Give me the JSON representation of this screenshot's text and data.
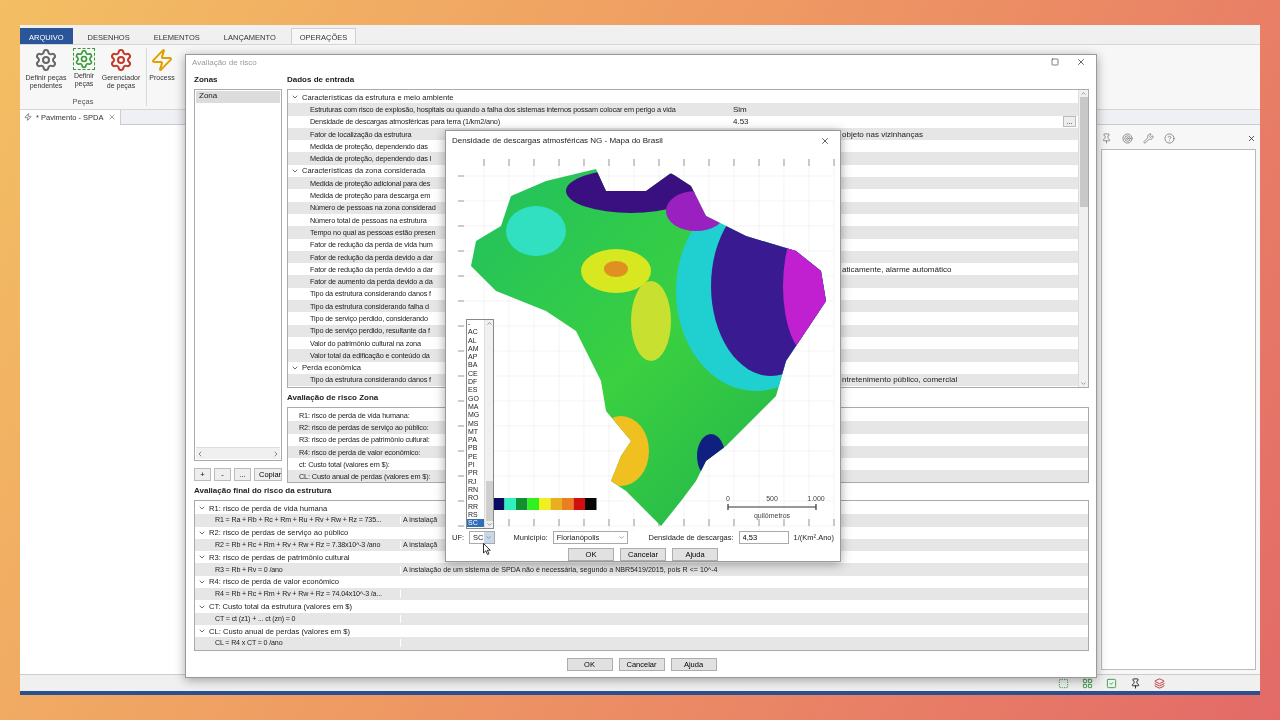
{
  "app": {
    "tabs": [
      {
        "label": "ARQUIVO",
        "kind": "file",
        "selected": false
      },
      {
        "label": "DESENHOS",
        "kind": "tab",
        "selected": false
      },
      {
        "label": "ELEMENTOS",
        "kind": "tab",
        "selected": false
      },
      {
        "label": "LANÇAMENTO",
        "kind": "tab",
        "selected": false
      },
      {
        "label": "OPERAÇÕES",
        "kind": "tab",
        "selected": true
      }
    ],
    "ribbon": {
      "buttons": [
        {
          "label": "Definir peças pendentes",
          "kind": "warn"
        },
        {
          "label": "Definir peças",
          "kind": "dashed"
        },
        {
          "label": "Gerenciador de peças",
          "kind": "manage"
        },
        {
          "label": "Process",
          "kind": "process"
        }
      ],
      "group_label": "Peças"
    },
    "document_tab": {
      "label": "* Pavimento - SPDA"
    }
  },
  "risk_dialog": {
    "title": "Avaliação de risco",
    "zones_heading": "Zonas",
    "zones": [
      {
        "label": "Zona",
        "selected": true
      }
    ],
    "zone_buttons": [
      "+",
      "-",
      "...",
      "Copiar"
    ],
    "input_heading": "Dados de entrada",
    "input_groups": [
      {
        "label": "Características da estrutura e meio ambiente",
        "expanded": true,
        "rows": [
          {
            "label": "Estruturas com risco de explosão, hospitais ou quando a falha dos sistemas internos possam colocar em perigo a vida",
            "value": "Sim"
          },
          {
            "label": "Densidade de descargas atmosféricas para terra (1/km2/ano)",
            "value": "4.53",
            "button": "..."
          },
          {
            "label": "Fator de localização da estrutura",
            "value": "objeto nas vizinhanças"
          },
          {
            "label": "Medida de proteção, dependendo das"
          },
          {
            "label": "Medida de proteção, dependendo das l"
          }
        ]
      },
      {
        "label": "Características da zona considerada",
        "expanded": true,
        "rows": [
          {
            "label": "Medida de proteção adicional para des"
          },
          {
            "label": "Medida de proteção para descarga em"
          },
          {
            "label": "Número de pessoas na zona considerad"
          },
          {
            "label": "Número total de pessoas na estrutura"
          },
          {
            "label": "Tempo no qual as pessoas estão presen"
          },
          {
            "label": "Fator de redução da perda de vida hum"
          },
          {
            "label": "Fator de redução da perda devido a dar"
          },
          {
            "label": "Fator de redução da perda devido a dar",
            "value": "aticamente, alarme automático"
          },
          {
            "label": "Fator de aumento da perda devido a da"
          },
          {
            "label": "Tipo da estrutura considerando danos f"
          },
          {
            "label": "Tipo da estrutura considerando falha d"
          },
          {
            "label": "Tipo de serviço perdido, considerando"
          },
          {
            "label": "Tipo de serviço perdido, resultante da f"
          },
          {
            "label": "Valor do patrimônio cultural na zona"
          },
          {
            "label": "Valor total da edificação e conteúdo da"
          }
        ]
      },
      {
        "label": "Perda econômica",
        "expanded": true,
        "rows": [
          {
            "label": "Tipo da estrutura considerando danos f",
            "value": "ntretenimento público, comercial"
          }
        ]
      }
    ],
    "risk_heading": "Avaliação de risco Zona",
    "risk_rows": [
      "R1: risco de perda de vida humana:",
      "R2: risco de perdas de serviço ao público:",
      "R3: risco de perdas de patrimônio cultural:",
      "R4: risco de perda de valor econômico:",
      "ct: Custo total (valores em $):",
      "CL: Custo anual de perdas (valores em $):"
    ],
    "final_heading": "Avaliação final do risco da estrutura",
    "final_groups": [
      {
        "label": "R1: risco de perda de vida humana",
        "expanded": true,
        "rows": [
          {
            "formula": "R1 = Ra + Rb + Rc + Rm + Ru + Rv + Rw + Rz = 735...",
            "note": "A instalaçã"
          }
        ]
      },
      {
        "label": "R2: risco de perdas de serviço ao público",
        "expanded": true,
        "rows": [
          {
            "formula": "R2 = Rb + Rc + Rm + Rv + Rw + Rz = 7.38x10^-3 /ano",
            "note": "A instalaçã"
          }
        ]
      },
      {
        "label": "R3: risco de perdas de patrimônio cultural",
        "expanded": true,
        "rows": [
          {
            "formula": "R3 = Rb + Rv = 0 /ano",
            "note": "A instalação de um sistema de SPDA não é necessária, segundo a NBR5419/2015, pois R <= 10^-4"
          }
        ]
      },
      {
        "label": "R4: risco de perda de valor econômico",
        "expanded": true,
        "rows": [
          {
            "formula": "R4 = Rb + Rc + Rm + Rv + Rw + Rz = 74.04x10^-3 /a..."
          }
        ]
      },
      {
        "label": "CT: Custo total da estrutura (valores em $)",
        "expanded": true,
        "rows": [
          {
            "formula": "CT = ct (z1) + ... ct (zn) = 0"
          }
        ]
      },
      {
        "label": "CL: Custo anual de perdas (valores em $)",
        "expanded": true,
        "rows": [
          {
            "formula": "CL = R4 x CT =  0 /ano"
          }
        ]
      }
    ],
    "buttons": [
      "OK",
      "Cancelar",
      "Ajuda"
    ]
  },
  "map_dialog": {
    "title": "Densidade de descargas atmosféricas NG - Mapa do Brasil",
    "scale_labels": [
      "0",
      "500",
      "1.000"
    ],
    "scale_unit": "quilômetros",
    "uf_label": "UF:",
    "uf_value": "SC",
    "uf_list": [
      {
        "label": "-",
        "selected": false
      },
      {
        "label": "AC",
        "selected": false
      },
      {
        "label": "AL",
        "selected": false
      },
      {
        "label": "AM",
        "selected": false
      },
      {
        "label": "AP",
        "selected": false
      },
      {
        "label": "BA",
        "selected": false
      },
      {
        "label": "CE",
        "selected": false
      },
      {
        "label": "DF",
        "selected": false
      },
      {
        "label": "ES",
        "selected": false
      },
      {
        "label": "GO",
        "selected": false
      },
      {
        "label": "MA",
        "selected": false
      },
      {
        "label": "MG",
        "selected": false
      },
      {
        "label": "MS",
        "selected": false
      },
      {
        "label": "MT",
        "selected": false
      },
      {
        "label": "PA",
        "selected": false
      },
      {
        "label": "PB",
        "selected": false
      },
      {
        "label": "PE",
        "selected": false
      },
      {
        "label": "PI",
        "selected": false
      },
      {
        "label": "PR",
        "selected": false
      },
      {
        "label": "RJ",
        "selected": false
      },
      {
        "label": "RN",
        "selected": false
      },
      {
        "label": "RO",
        "selected": false
      },
      {
        "label": "RR",
        "selected": false
      },
      {
        "label": "RS",
        "selected": false
      },
      {
        "label": "SC",
        "selected": true
      }
    ],
    "municipio_label": "Município:",
    "municipio_value": "Florianópolis",
    "density_label": "Densidade de descargas:",
    "density_value": "4,53",
    "density_unit": "1/(Km².Ano)",
    "buttons": [
      "OK",
      "Cancelar",
      "Ajuda"
    ]
  }
}
